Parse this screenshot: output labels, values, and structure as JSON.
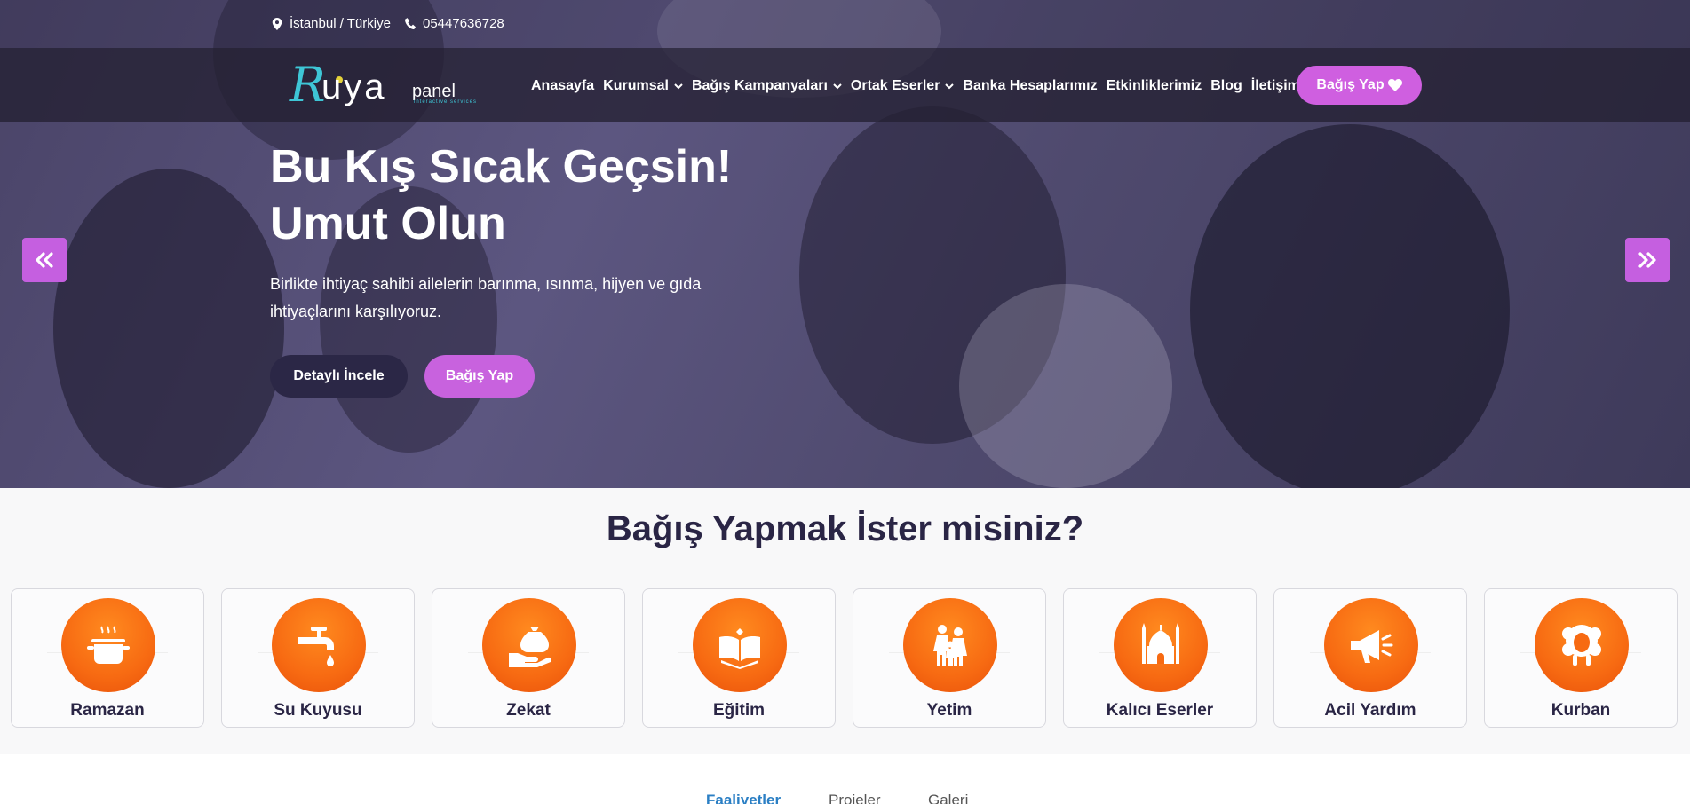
{
  "topbar": {
    "location": "İstanbul / Türkiye",
    "phone": "05447636728"
  },
  "logo": {
    "first_letter": "R",
    "rest": "uya",
    "suffix": "panel",
    "tagline": "interactive services"
  },
  "nav": {
    "items": [
      {
        "label": "Anasayfa",
        "dropdown": false
      },
      {
        "label": "Kurumsal",
        "dropdown": true
      },
      {
        "label": "Bağış Kampanyaları",
        "dropdown": true
      },
      {
        "label": "Ortak Eserler",
        "dropdown": true
      },
      {
        "label": "Banka Hesaplarımız",
        "dropdown": false
      },
      {
        "label": "Etkinliklerimiz",
        "dropdown": false
      },
      {
        "label": "Blog",
        "dropdown": false
      },
      {
        "label": "İletişim",
        "dropdown": false
      }
    ],
    "donate_label": "Bağış Yap"
  },
  "hero": {
    "title_line1": "Bu Kış Sıcak Geçsin!",
    "title_line2": "Umut Olun",
    "text": "Birlikte ihtiyaç sahibi ailelerin barınma, ısınma, hijyen ve gıda ihtiyaçlarını karşılıyoruz.",
    "detail_button": "Detaylı İncele",
    "donate_button": "Bağış Yap"
  },
  "donate_section": {
    "title": "Bağış Yapmak İster misiniz?",
    "categories": [
      {
        "label": "Ramazan",
        "icon": "cooking-pot-icon"
      },
      {
        "label": "Su Kuyusu",
        "icon": "water-tap-icon"
      },
      {
        "label": "Zekat",
        "icon": "hand-money-bag-icon"
      },
      {
        "label": "Eğitim",
        "icon": "open-book-icon"
      },
      {
        "label": "Yetim",
        "icon": "family-icon"
      },
      {
        "label": "Kalıcı Eserler",
        "icon": "mosque-icon"
      },
      {
        "label": "Acil Yardım",
        "icon": "megaphone-icon"
      },
      {
        "label": "Kurban",
        "icon": "sheep-icon"
      }
    ]
  },
  "tabs": {
    "items": [
      {
        "label": "Faaliyetler",
        "active": true
      },
      {
        "label": "Projeler",
        "active": false
      },
      {
        "label": "Galeri",
        "active": false
      }
    ]
  },
  "colors": {
    "accent_purple": "#c862de",
    "dark_navy": "#2b2746",
    "icon_orange": "#f76a12",
    "tab_active": "#2b7fc4"
  }
}
